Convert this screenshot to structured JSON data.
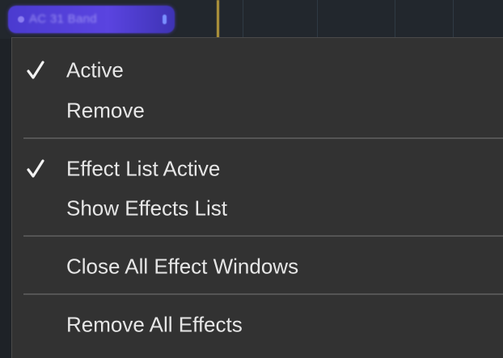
{
  "background": {
    "effect_chip_label": "AC 31 Band",
    "chip_color": "#5a44e0",
    "playhead_color": "#b89a3c"
  },
  "menu": {
    "items": [
      {
        "label": "Active",
        "checked": true
      },
      {
        "label": "Remove",
        "checked": false
      },
      {
        "label": "Effect List Active",
        "checked": true
      },
      {
        "label": "Show Effects List",
        "checked": false
      },
      {
        "label": "Close All Effect Windows",
        "checked": false
      },
      {
        "label": "Remove All Effects",
        "checked": false
      }
    ],
    "check_icon": "checkmark-icon",
    "text_color": "#e6e6e6",
    "background_color": "#323232",
    "separator_color": "#555555"
  }
}
